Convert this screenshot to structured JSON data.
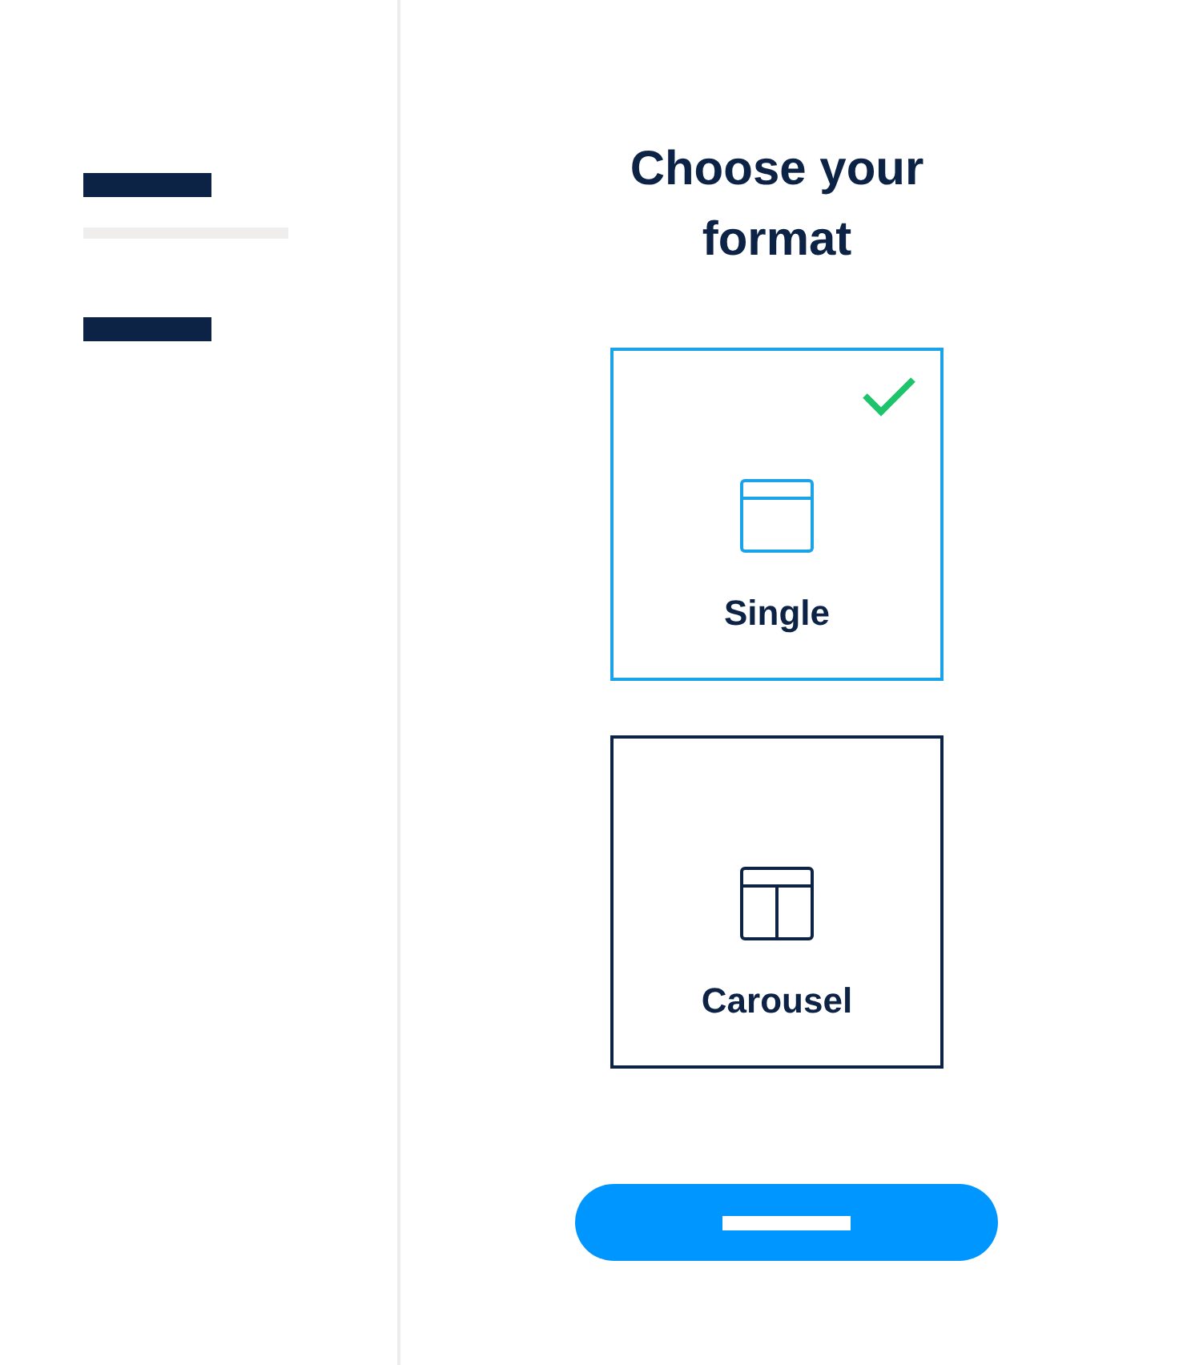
{
  "title": "Choose your format",
  "formats": [
    {
      "label": "Single",
      "kind": "single",
      "selected": true
    },
    {
      "label": "Carousel",
      "kind": "carousel",
      "selected": false
    }
  ]
}
